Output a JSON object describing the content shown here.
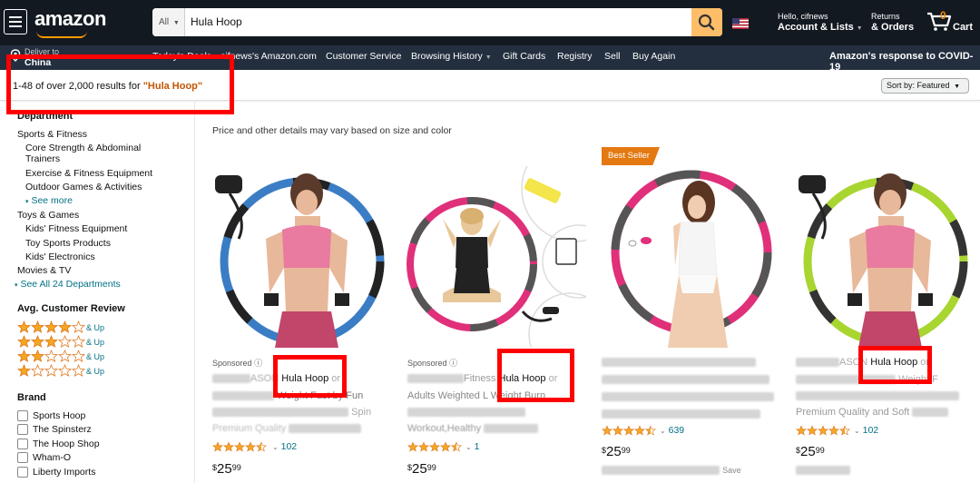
{
  "header": {
    "logo": "amazon",
    "search_category": "All",
    "search_value": "Hula Hoop",
    "account_greeting": "Hello, cifnews",
    "account_label": "Account & Lists",
    "returns_label": "Returns",
    "orders_label": "& Orders",
    "cart_count": "0",
    "cart_label": "Cart"
  },
  "subnav": {
    "deliver_to": "Deliver to",
    "deliver_location": "China",
    "items": [
      "Today's Deals",
      "cifnews's Amazon.com",
      "Customer Service",
      "Browsing History",
      "Gift Cards",
      "Registry",
      "Sell",
      "Buy Again"
    ],
    "promo": "Amazon's response to COVID-19"
  },
  "results": {
    "range": "1-48 of over 2,000 results for ",
    "query": "\"Hula Hoop\"",
    "sort_label": "Sort by:",
    "sort_value": "Featured"
  },
  "sidebar": {
    "department_heading": "Department",
    "departments": [
      {
        "label": "Sports & Fitness",
        "level": 0
      },
      {
        "label": "Core Strength & Abdominal",
        "level": 1
      },
      {
        "label": "Trainers",
        "level": 1
      },
      {
        "label": "Exercise & Fitness Equipment",
        "level": 1
      },
      {
        "label": "Outdoor Games & Activities",
        "level": 1
      },
      {
        "label": "See more",
        "level": 1
      },
      {
        "label": "Toys & Games",
        "level": 0
      },
      {
        "label": "Kids' Fitness Equipment",
        "level": 1
      },
      {
        "label": "Toy Sports Products",
        "level": 1
      },
      {
        "label": "Kids' Electronics",
        "level": 1
      },
      {
        "label": "Movies & TV",
        "level": 0
      },
      {
        "label": "See All 24 Departments",
        "level": 0
      }
    ],
    "review_heading": "Avg. Customer Review",
    "review_rows": [
      {
        "stars": 4,
        "label": "& Up"
      },
      {
        "stars": 3,
        "label": "& Up"
      },
      {
        "stars": 2,
        "label": "& Up"
      },
      {
        "stars": 1,
        "label": "& Up"
      }
    ],
    "brand_heading": "Brand",
    "brands": [
      "Sports Hoop",
      "The Spinsterz",
      "The Hoop Shop",
      "Wham-O",
      "Liberty Imports"
    ]
  },
  "main": {
    "disclaimer": "Price and other details may vary based on size and color",
    "products": [
      {
        "sponsored": "Sponsored",
        "title_visible_1": "Hula Hoop",
        "title_suffix_1": "or",
        "title_prefix_1": "ASON",
        "title_line2_end": "Weight Fast by Fun",
        "title_line3_mid": "Spin",
        "title_line4": "Premium Quality",
        "rating": 4.5,
        "reviews": "102",
        "price_whole": "25",
        "price_fraction": "99"
      },
      {
        "sponsored": "Sponsored",
        "title_visible_1": "Hula Hoop",
        "title_suffix_1": "or",
        "title_prefix_1": "Fitness",
        "title_line2_start": "Adults Weighted L",
        "title_line2_end": "Weight Burn",
        "title_line4": "Workout,Healthy",
        "rating": 4.5,
        "reviews": "1",
        "price_whole": "25",
        "price_fraction": "99"
      },
      {
        "badge": "Best Seller",
        "rating": 4.5,
        "reviews": "639",
        "price_whole": "25",
        "price_fraction": "99",
        "save_text": "Save"
      },
      {
        "title_prefix_1": "ASON",
        "title_visible_1": "Hula Hoop",
        "title_suffix_1": "or",
        "title_line2_end": "Weight F",
        "title_line4": "Premium Quality and Soft",
        "rating": 4.5,
        "reviews": "102",
        "price_whole": "25",
        "price_fraction": "99"
      }
    ]
  },
  "colors": {
    "nav_dark": "#131921",
    "subnav": "#232f3e",
    "accent_orange": "#febd69",
    "highlight_red": "#ff0000",
    "link_teal": "#007185",
    "star_orange": "#f5a623",
    "query_orange": "#c45500"
  }
}
